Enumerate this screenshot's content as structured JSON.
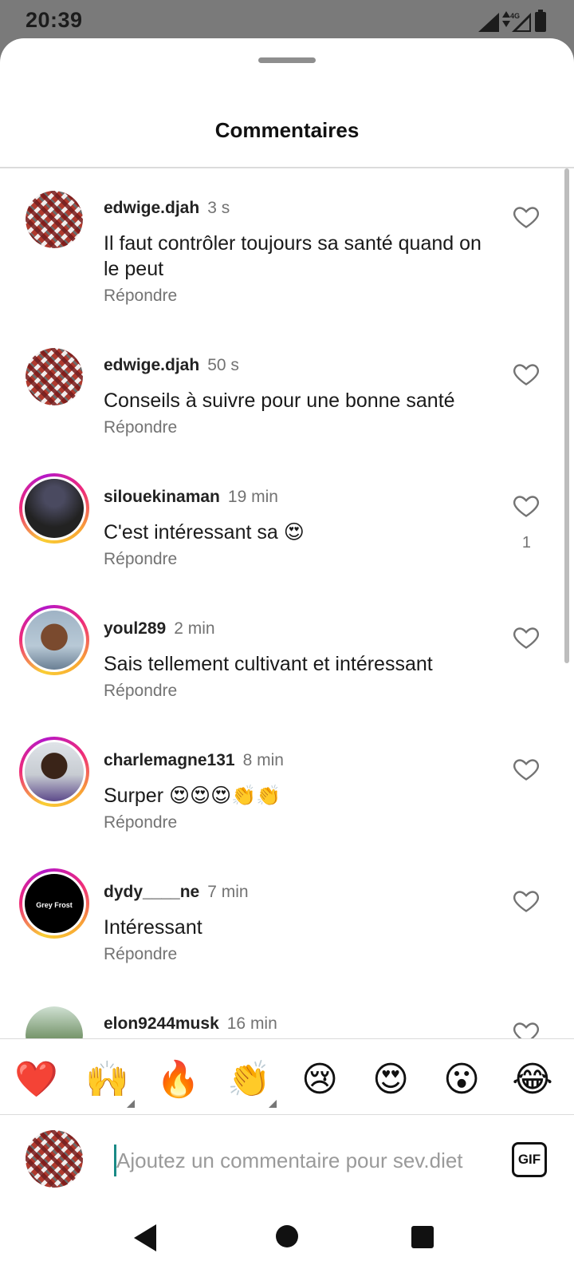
{
  "status_bar": {
    "time": "20:39",
    "network_label": "4G",
    "icons": [
      "signal-icon",
      "network-4g-icon",
      "battery-icon"
    ]
  },
  "sheet": {
    "title": "Commentaires"
  },
  "comments": [
    {
      "username": "edwige.djah",
      "time": "3 s",
      "text": "Il faut contrôler toujours sa santé quand on le peut",
      "reply_label": "Répondre",
      "likes": "",
      "avatar": "patterned-avatar",
      "story_ring": false
    },
    {
      "username": "edwige.djah",
      "time": "50 s",
      "text": "Conseils à suivre pour une bonne santé",
      "reply_label": "Répondre",
      "likes": "",
      "avatar": "patterned-avatar",
      "story_ring": false
    },
    {
      "username": "silouekinaman",
      "time": "19 min",
      "text": "C'est intéressant sa 😍",
      "reply_label": "Répondre",
      "likes": "1",
      "avatar": "screen-photo-avatar",
      "story_ring": true
    },
    {
      "username": "youl289",
      "time": "2 min",
      "text": "Sais tellement cultivant et intéressant",
      "reply_label": "Répondre",
      "likes": "",
      "avatar": "face-photo-avatar",
      "story_ring": true
    },
    {
      "username": "charlemagne131",
      "time": "8 min",
      "text": "Surper 😍😍😍👏👏",
      "reply_label": "Répondre",
      "likes": "",
      "avatar": "face-photo-avatar",
      "story_ring": true
    },
    {
      "username": "dydy____ne",
      "time": "7 min",
      "text": "Intéressant",
      "reply_label": "Répondre",
      "likes": "",
      "avatar": "black-avatar",
      "avatar_text": "Grey Frost",
      "story_ring": true
    },
    {
      "username": "elon9244musk",
      "time": "16 min",
      "text": "",
      "reply_label": "",
      "likes": "",
      "avatar": "landscape-avatar",
      "story_ring": false
    }
  ],
  "quick_reactions": [
    "❤️",
    "🙌",
    "🔥",
    "👏",
    "😢",
    "😍",
    "😮",
    "😂"
  ],
  "composer": {
    "placeholder": "Ajoutez un commentaire pour sev.diet",
    "gif_label": "GIF"
  },
  "nav": {
    "icons": [
      "back-icon",
      "home-icon",
      "recents-icon"
    ]
  }
}
